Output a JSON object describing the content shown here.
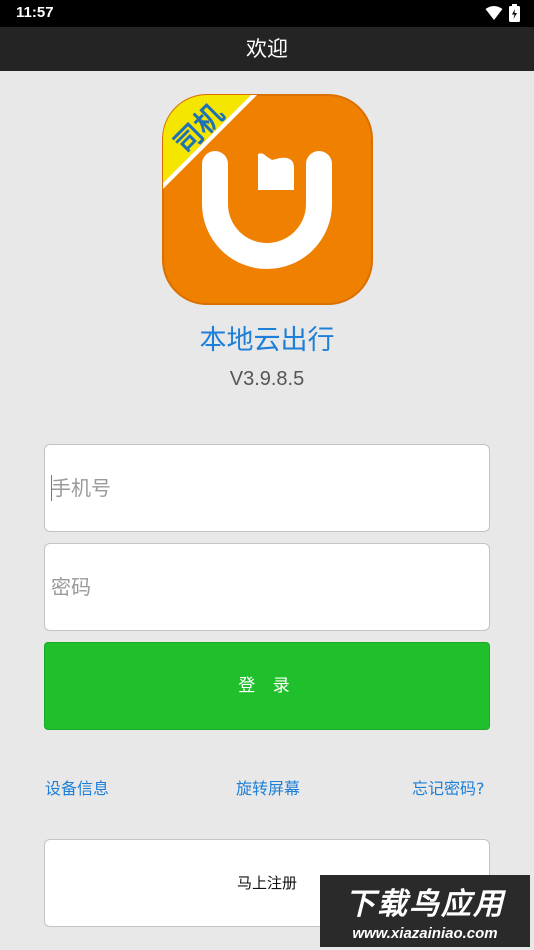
{
  "status_bar": {
    "time": "11:57"
  },
  "header": {
    "title": "欢迎"
  },
  "app": {
    "badge": "司机",
    "name": "本地云出行",
    "version": "V3.9.8.5"
  },
  "form": {
    "phone_placeholder": "手机号",
    "password_placeholder": "密码",
    "login_label": "登 录"
  },
  "links": {
    "device_info": "设备信息",
    "rotate_screen": "旋转屏幕",
    "forgot_password": "忘记密码?"
  },
  "register_label": "马上注册",
  "watermark": {
    "main": "下载鸟应用",
    "sub": "www.xiazainiao.com"
  },
  "colors": {
    "accent": "#1e7fd8",
    "login": "#20c02d",
    "logo_orange": "#f08000",
    "badge_yellow": "#f5e600"
  }
}
